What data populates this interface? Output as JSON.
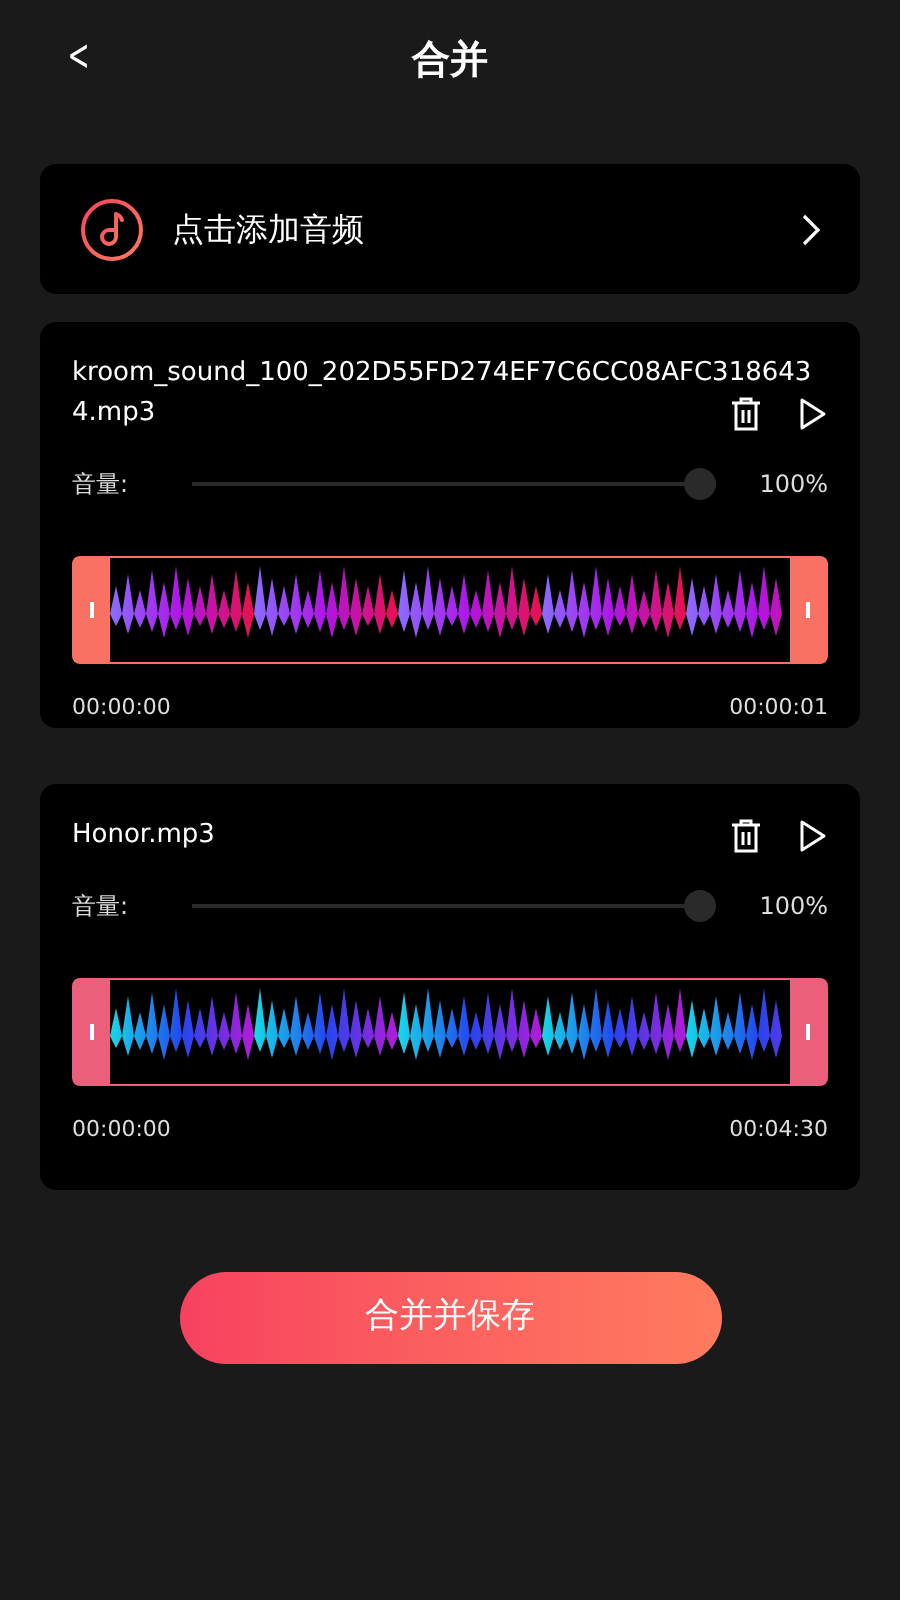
{
  "header": {
    "back": "<",
    "title": "合并"
  },
  "add_audio": {
    "label": "点击添加音频"
  },
  "clips": [
    {
      "name_lines": [
        "kroom_sound_100_202D55FD274EF7C6CC08AFC318643",
        "4.mp3"
      ],
      "volume_label": "音量:",
      "level": 1,
      "volume": "100%",
      "color": "#f87163",
      "start": "00:00:00",
      "end": "00:00:01"
    },
    {
      "name_lines": [
        "Honor.mp3"
      ],
      "volume_label": "音量:",
      "level": 1,
      "volume": "100%",
      "color": "#ec5f7a",
      "start": "00:00:00",
      "end": "00:04:30"
    }
  ],
  "save_button": "合并并保存"
}
